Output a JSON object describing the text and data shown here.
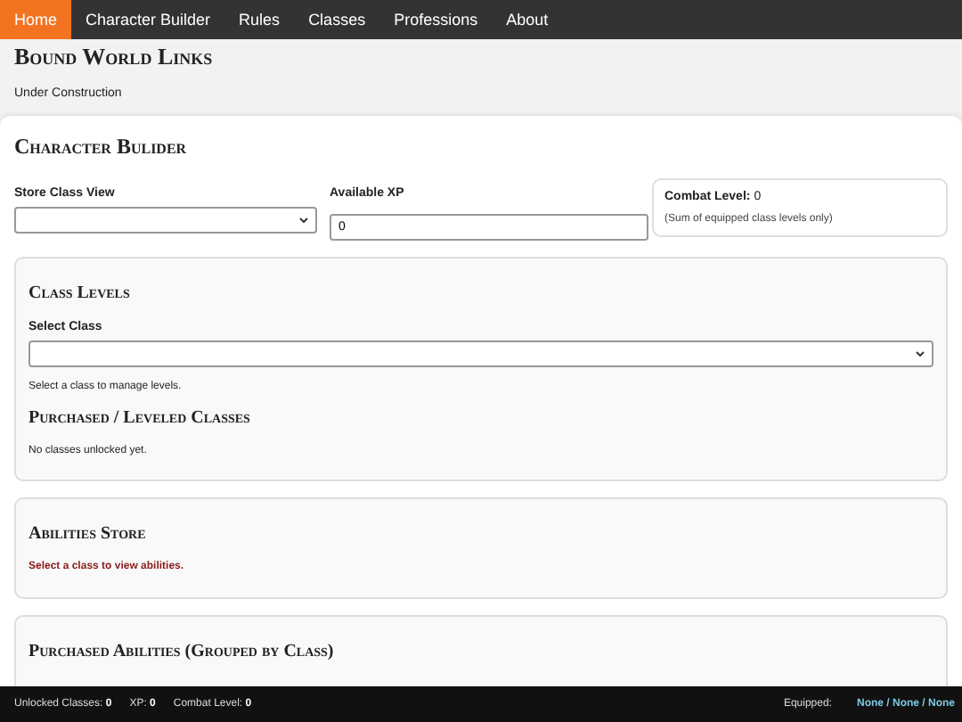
{
  "nav": [
    {
      "label": "Home",
      "selected": true
    },
    {
      "label": "Character Builder",
      "selected": false
    },
    {
      "label": "Rules",
      "selected": false
    },
    {
      "label": "Classes",
      "selected": false
    },
    {
      "label": "Professions",
      "selected": false
    },
    {
      "label": "About",
      "selected": false
    }
  ],
  "header": {
    "title": "Bound World Links",
    "subtitle": "Under Construction"
  },
  "builder": {
    "title": "Character Bulider",
    "store_class_view": {
      "label": "Store Class View"
    },
    "available_xp": {
      "label": "Available XP",
      "value": "0"
    },
    "combat": {
      "label": "Combat Level:",
      "value": "0",
      "note": "(Sum of equipped class levels only)"
    }
  },
  "class_levels": {
    "title": "Class Levels",
    "select_label": "Select Class",
    "hint": "Select a class to manage levels.",
    "purchased_title": "Purchased / Leveled Classes",
    "purchased_empty": "No classes unlocked yet."
  },
  "abilities_store": {
    "title": "Abilities Store",
    "message": "Select a class to view abilities."
  },
  "purchased_abilities": {
    "title": "Purchased Abilities (Grouped by Class)"
  },
  "status_bar": {
    "stats": [
      {
        "label": "Unlocked Classes:",
        "value": "0"
      },
      {
        "label": "XP:",
        "value": "0"
      },
      {
        "label": "Combat Level:",
        "value": "0"
      }
    ],
    "equipped_label": "Equipped:",
    "equipped_value": "None / None / None"
  }
}
